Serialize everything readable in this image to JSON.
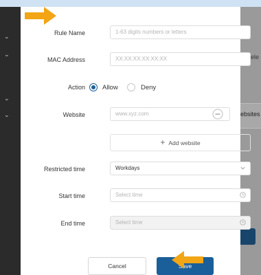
{
  "form": {
    "rule_name": {
      "label": "Rule Name",
      "placeholder": "1-63 digits numbers or letters",
      "value": ""
    },
    "mac_address": {
      "label": "MAC Address",
      "placeholder": "XX:XX:XX:XX:XX:XX",
      "value": ""
    },
    "action": {
      "label": "Action",
      "options": [
        "Allow",
        "Deny"
      ],
      "selected": "Allow"
    },
    "website": {
      "label": "Website",
      "placeholder": "www.xyz.com",
      "value": ""
    },
    "add_website": {
      "label": "Add website",
      "icon": "plus-icon"
    },
    "restricted_time": {
      "label": "Restricted time",
      "value": "Workdays",
      "icon": "chevron-down-icon"
    },
    "start_time": {
      "label": "Start time",
      "placeholder": "Select time",
      "icon": "clock-icon"
    },
    "end_time": {
      "label": "End time",
      "placeholder": "Select time",
      "disabled": true,
      "icon": "clock-icon"
    }
  },
  "buttons": {
    "cancel": "Cancel",
    "save": "Save"
  },
  "background": {
    "hint_text": "or sele",
    "tab_text": "ebsites"
  },
  "colors": {
    "accent": "#1a5f99",
    "annotation_arrow": "#f2a515",
    "sidebar": "#2b2b2b",
    "overlay": "#8a8a8a"
  }
}
